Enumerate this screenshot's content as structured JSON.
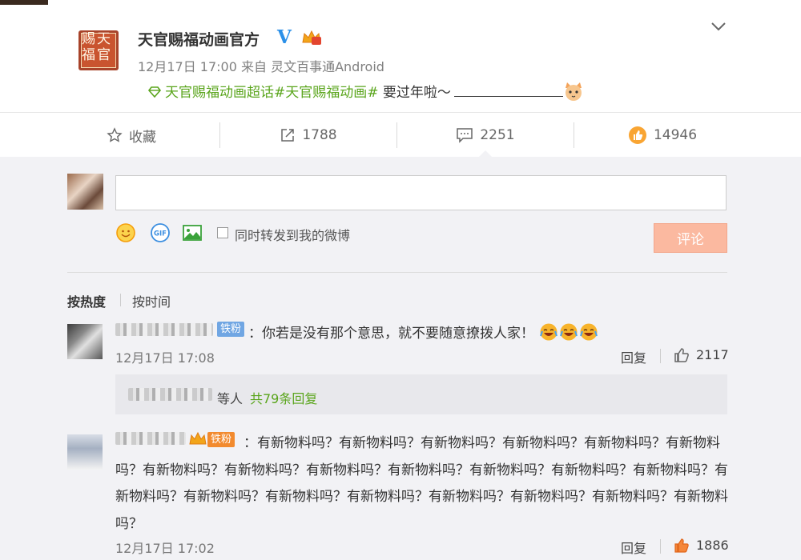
{
  "post": {
    "author": "天官赐福动画官方",
    "verified_mark": "V",
    "logo_chars": [
      "赐",
      "天",
      "福",
      "官"
    ],
    "meta": "12月17日 17:00 来自 灵文百事通Android",
    "topic1": "天官赐福动画超话",
    "topic2": "#天官赐福动画#",
    "body_text": " 要过年啦～",
    "icons": {
      "topic": "super-topic-diamond-icon",
      "cat": "cat-face-emoji",
      "menu": "chevron-down-icon",
      "badge": "crown-member-icon"
    }
  },
  "actions": {
    "favorite": "收藏",
    "repost_count": "1788",
    "comment_count": "2251",
    "like_count": "14946"
  },
  "composer": {
    "placeholder": "",
    "repost_label": "同时转发到我的微博",
    "submit_label": "评论"
  },
  "sort": {
    "hot": "按热度",
    "time": "按时间"
  },
  "comments": [
    {
      "badge": "铁粉",
      "text": "：你若是没有那个意思，就不要随意撩拨人家！",
      "time": "12月17日 17:08",
      "reply_label": "回复",
      "likes": "2117",
      "sub_etc": "等人",
      "sub_count": "共79条回复"
    },
    {
      "badge": "铁粉",
      "text": "：有新物料吗？有新物料吗？有新物料吗？有新物料吗？有新物料吗？有新物料吗？有新物料吗？有新物料吗？有新物料吗？有新物料吗？有新物料吗？有新物料吗？有新物料吗？有新物料吗？有新物料吗？有新物料吗？有新物料吗？有新物料吗？有新物料吗？有新物料吗？有新物料吗？",
      "time": "12月17日 17:02",
      "reply_label": "回复",
      "likes": "1886"
    }
  ],
  "colors": {
    "topic_green": "#5aa51c",
    "verified_blue": "#2b90e8",
    "submit_bg": "#fbb9a0",
    "fan_badge_blue": "#70a6e3",
    "like_orange": "#f28a2e"
  }
}
